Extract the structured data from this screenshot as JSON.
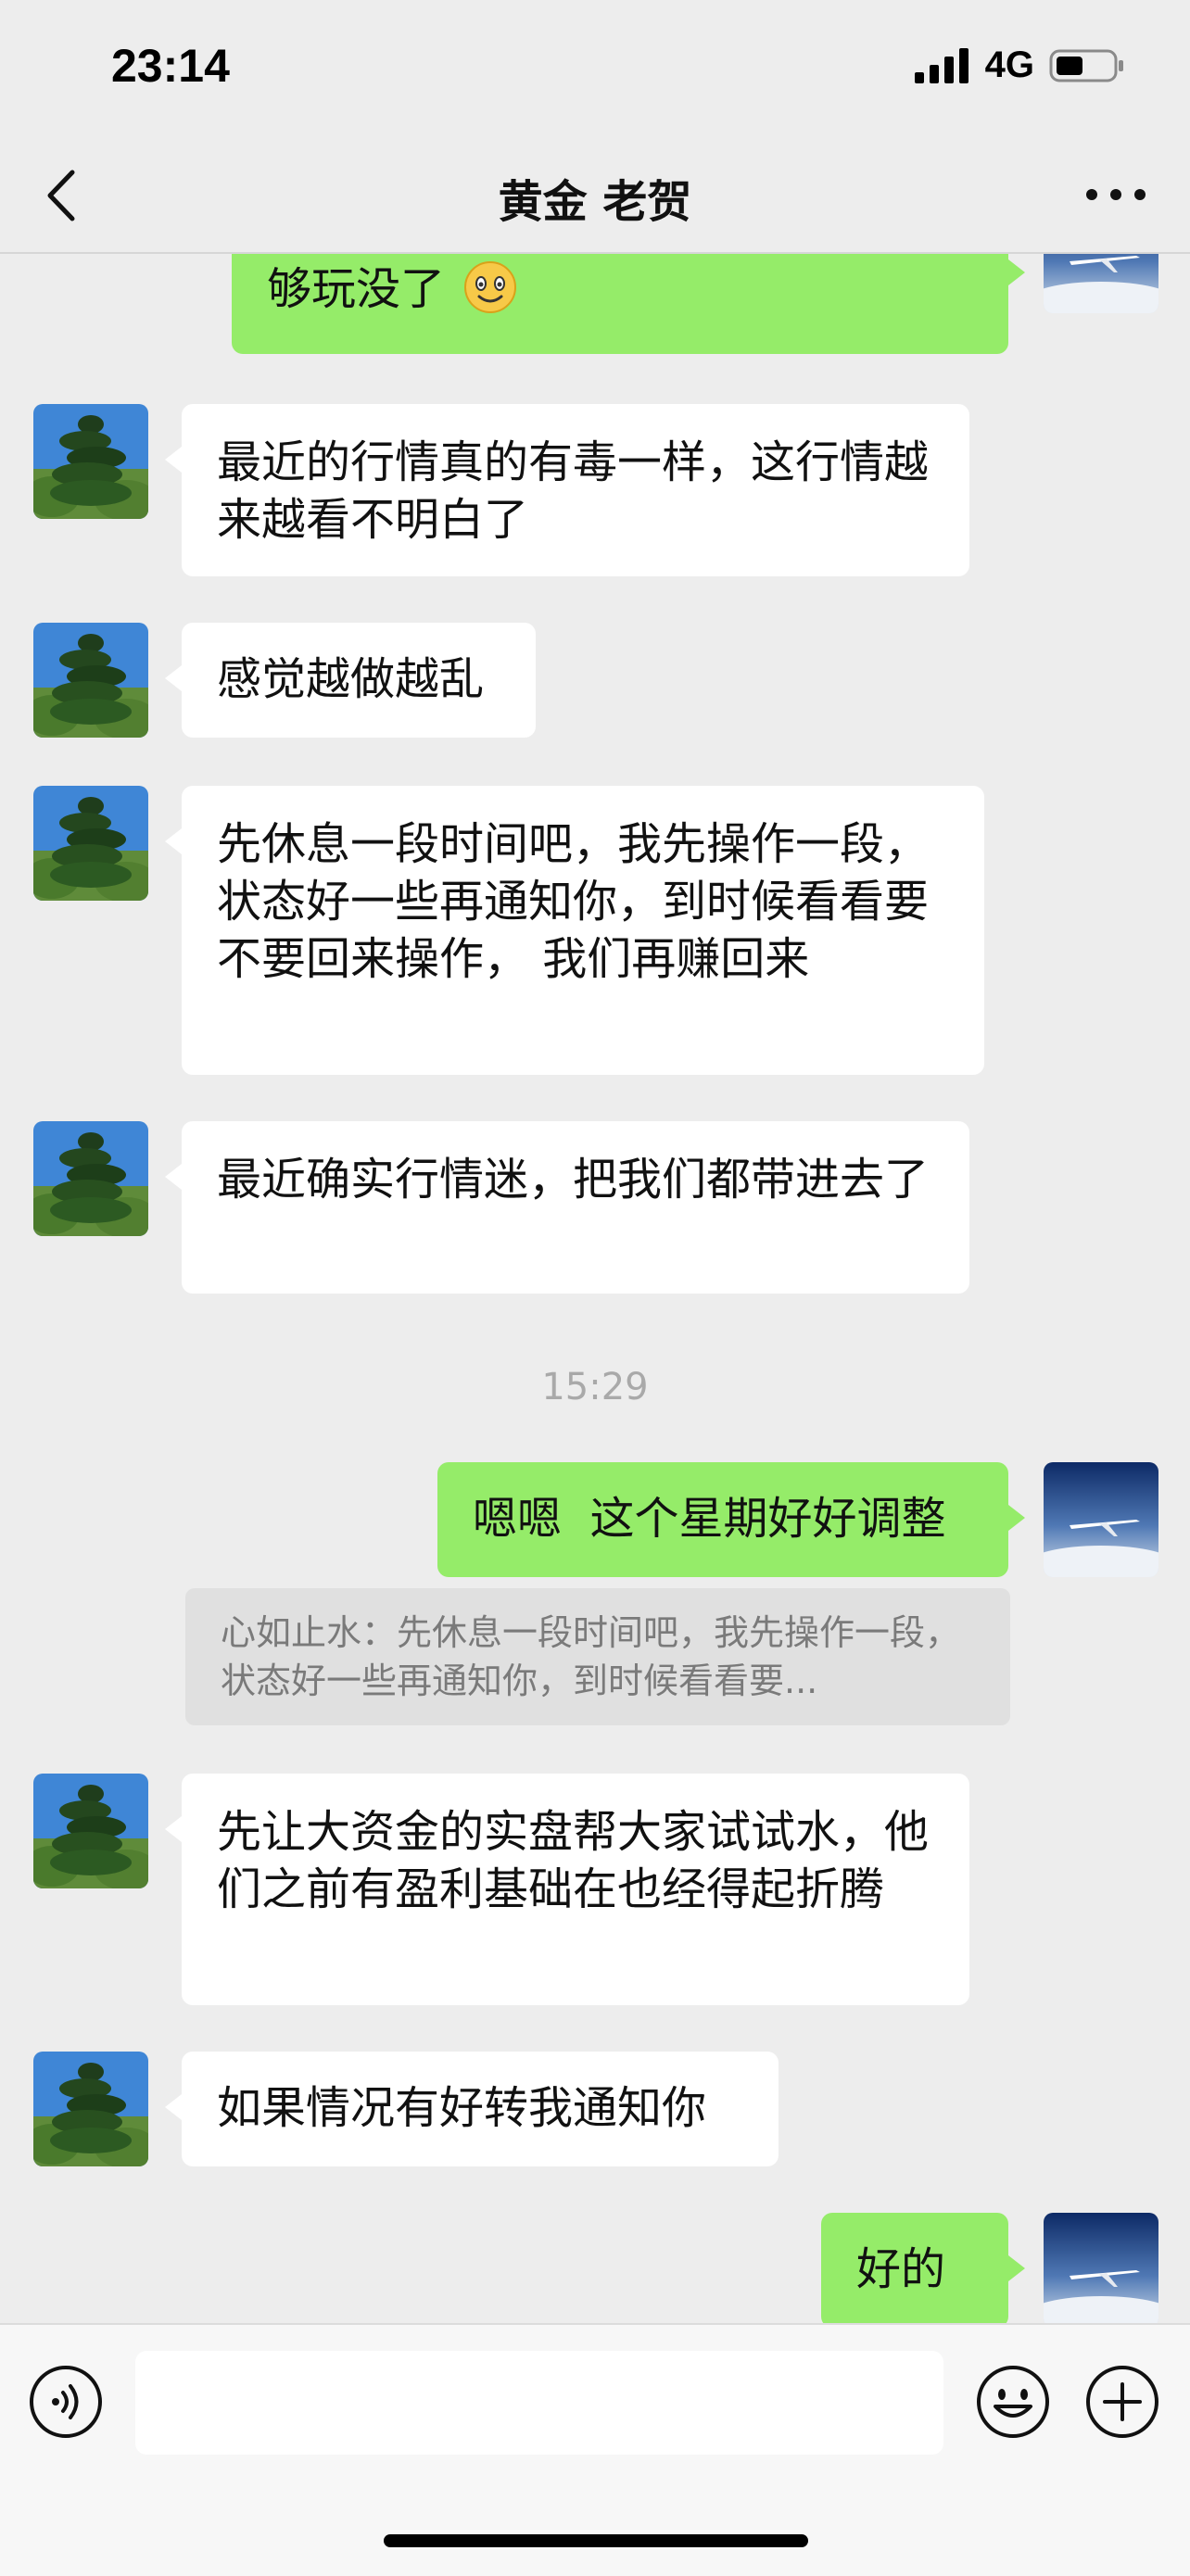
{
  "status_bar": {
    "time": "23:14",
    "network": "4G",
    "icons": [
      "signal-icon",
      "battery-icon"
    ]
  },
  "nav": {
    "title": "黄金 老贺",
    "icons": [
      "back-icon",
      "more-icon"
    ]
  },
  "messages": {
    "m0": {
      "sender": "me",
      "text": "够玩没了",
      "note": "partially scrolled out",
      "trailing_icon": "smiling-emoji-icon"
    },
    "m1": {
      "sender": "contact",
      "text": "最近的行情真的有毒一样，这行情越来越看不明白了"
    },
    "m2": {
      "sender": "contact",
      "text": "感觉越做越乱"
    },
    "m3": {
      "sender": "contact",
      "text": "先休息一段时间吧，我先操作一段，状态好一些再通知你，到时候看看要不要回来操作， 我们再赚回来"
    },
    "m4": {
      "sender": "contact",
      "text": "最近确实行情迷，把我们都带进去了"
    },
    "ts1": {
      "type": "timestamp",
      "text": "15:29"
    },
    "m5": {
      "sender": "me",
      "text": "嗯嗯  这个星期好好调整"
    },
    "q5": {
      "type": "quote",
      "text": "心如止水：先休息一段时间吧，我先操作一段，状态好一些再通知你，到时候看看要..."
    },
    "m6": {
      "sender": "contact",
      "text": "先让大资金的实盘帮大家试试水，他们之前有盈利基础在也经得起折腾"
    },
    "m7": {
      "sender": "contact",
      "text": "如果情况有好转我通知你"
    },
    "m8": {
      "sender": "me",
      "text": "好的"
    }
  },
  "input_bar": {
    "text_value": "",
    "icons": [
      "voice-icon",
      "emoji-icon",
      "plus-icon"
    ]
  },
  "colors": {
    "background": "#ededed",
    "bubble_out": "#95ec69",
    "bubble_in": "#ffffff",
    "quote_bg": "#e0e0e0",
    "timestamp": "#a9a9a9"
  }
}
